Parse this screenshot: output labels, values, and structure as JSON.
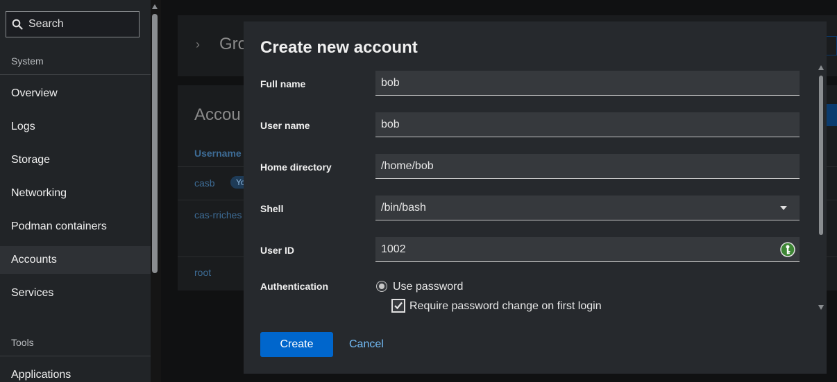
{
  "sidebar": {
    "search_placeholder": "Search",
    "sections": [
      {
        "label": "System"
      },
      {
        "label": "Tools"
      }
    ],
    "items": [
      {
        "label": "Overview"
      },
      {
        "label": "Logs"
      },
      {
        "label": "Storage"
      },
      {
        "label": "Networking"
      },
      {
        "label": "Podman containers"
      },
      {
        "label": "Accounts",
        "active": true
      },
      {
        "label": "Services"
      },
      {
        "label": "Applications"
      }
    ]
  },
  "background": {
    "groups_title": "Gro",
    "accounts_title": "Accou",
    "username_header": "Username",
    "rows": [
      {
        "username": "casb",
        "badge": "Yo"
      },
      {
        "username": "cas-rriches"
      },
      {
        "username": "root"
      }
    ]
  },
  "modal": {
    "title": "Create new account",
    "fields": {
      "full_name": {
        "label": "Full name",
        "value": "bob"
      },
      "user_name": {
        "label": "User name",
        "value": "bob"
      },
      "home_directory": {
        "label": "Home directory",
        "value": "/home/bob"
      },
      "shell": {
        "label": "Shell",
        "value": "/bin/bash"
      },
      "user_id": {
        "label": "User ID",
        "value": "1002"
      }
    },
    "authentication": {
      "label": "Authentication",
      "option": "Use password",
      "require_change": "Require password change on first login"
    },
    "create_label": "Create",
    "cancel_label": "Cancel"
  },
  "colors": {
    "accent": "#0066cc",
    "link": "#73bcf7",
    "ok": "#3e8635"
  }
}
